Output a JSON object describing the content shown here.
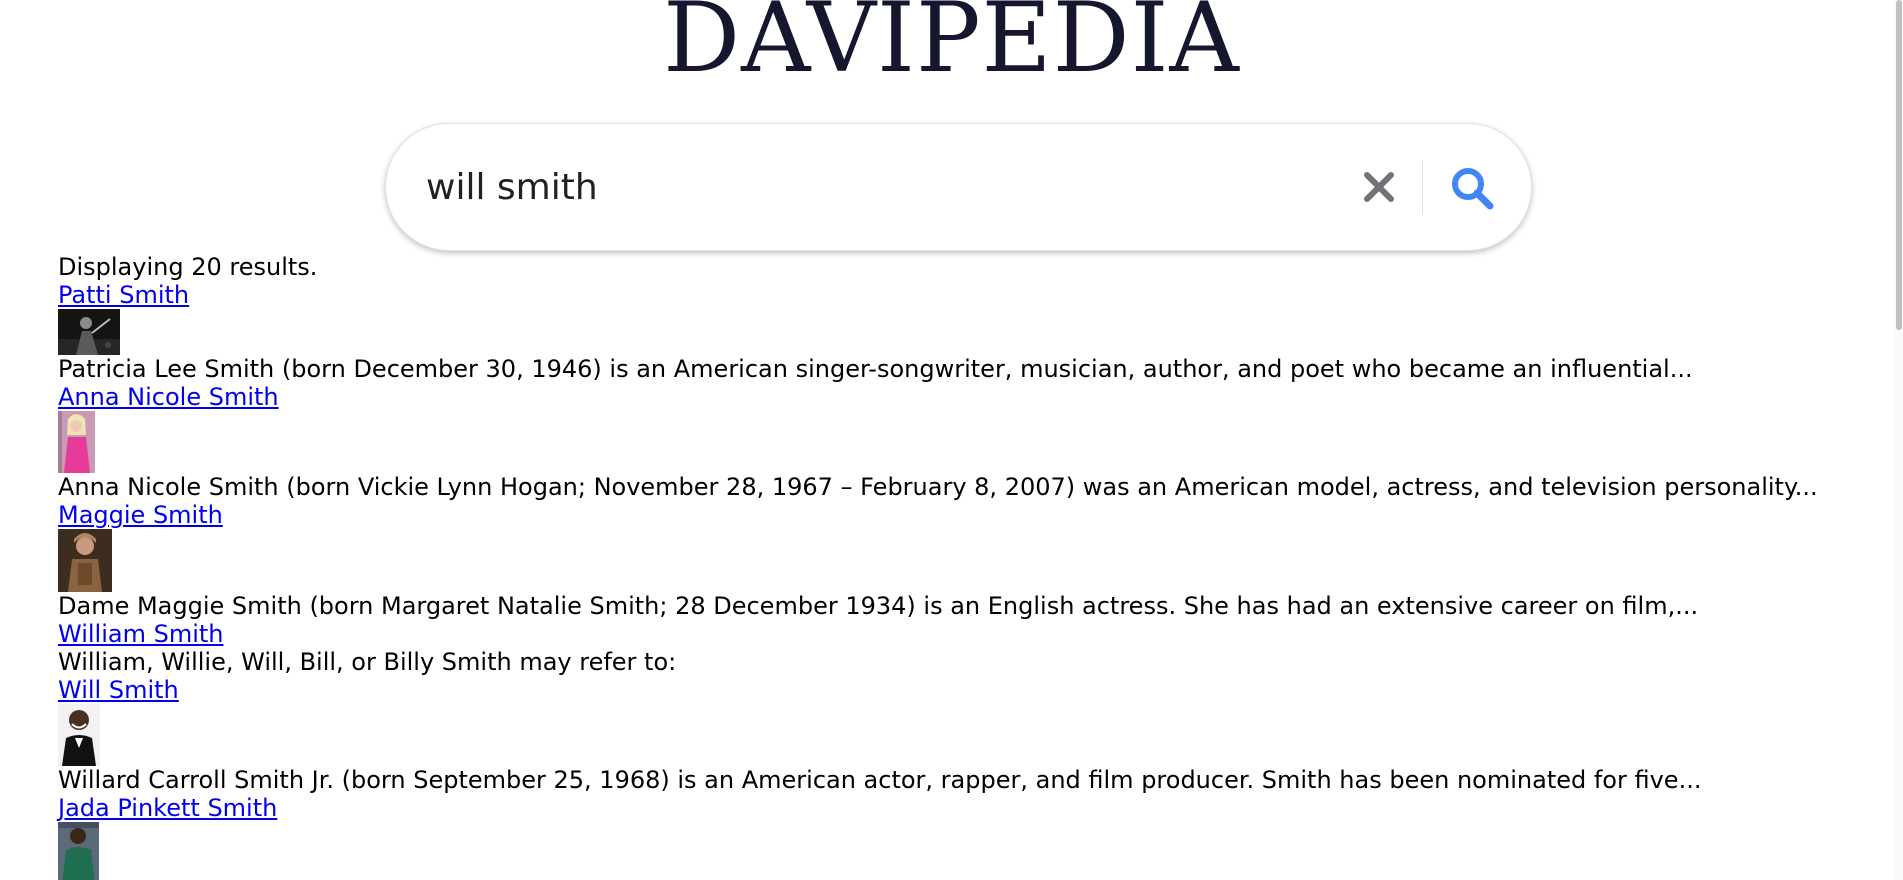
{
  "logo": "DAVIPEDIA",
  "search": {
    "value": "will smith",
    "clear_icon": "close-icon",
    "submit_icon": "search-icon",
    "accent_color": "#4285f4"
  },
  "results": {
    "summary": "Displaying 20 results.",
    "items": [
      {
        "title": "Patti Smith",
        "description": "Patricia Lee Smith (born December 30, 1946) is an American singer-songwriter, musician, author, and poet who became an influential...",
        "has_image": true
      },
      {
        "title": "Anna Nicole Smith",
        "description": "Anna Nicole Smith (born Vickie Lynn Hogan; November 28, 1967 – February 8, 2007) was an American model, actress, and television personality...",
        "has_image": true
      },
      {
        "title": "Maggie Smith",
        "description": "Dame Maggie Smith (born Margaret Natalie Smith; 28 December 1934) is an English actress. She has had an extensive career on film,...",
        "has_image": true
      },
      {
        "title": "William Smith",
        "description": "William, Willie, Will, Bill, or Billy Smith may refer to:",
        "has_image": false
      },
      {
        "title": "Will Smith",
        "description": "Willard Carroll Smith Jr. (born September 25, 1968) is an American actor, rapper, and film producer. Smith has been nominated for five...",
        "has_image": true
      },
      {
        "title": "Jada Pinkett Smith",
        "description": "",
        "has_image": true
      }
    ]
  }
}
